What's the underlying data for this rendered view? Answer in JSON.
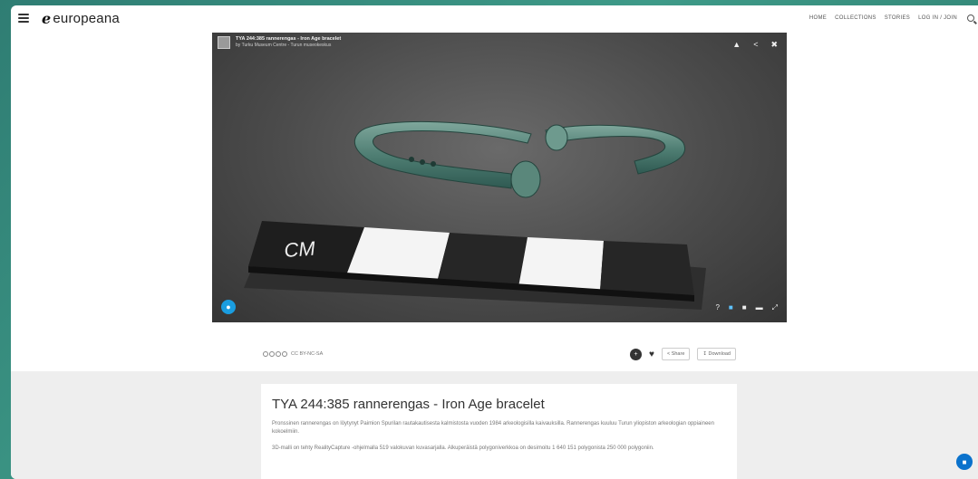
{
  "header": {
    "logo_mark": "e",
    "logo_text": "europeana",
    "nav": [
      "HOME",
      "COLLECTIONS",
      "STORIES",
      "LOG IN / JOIN"
    ]
  },
  "viewer": {
    "title": "TYA 244:385 rannerengas - Iron Age bracelet",
    "subtitle": "by Turku Museum Centre - Turun museokeskus",
    "scale_label": "CM"
  },
  "actions": {
    "license": "CC BY-NC-SA",
    "share": "Share",
    "download": "Download"
  },
  "record": {
    "title": "TYA 244:385 rannerengas - Iron Age bracelet",
    "description": "Pronssinen rannerengas on löytynyt Paimion Spurilan rautakautisesta kalmistosta vuoden 1984 arkeologisilla kaivauksilla. Rannerengas kuuluu Turun yliopiston arkeologian oppiaineen kokoelmiin.",
    "description2": "3D-malli on tehty RealityCapture -ohjelmalla 519 valokuvan kuvasarjalla. Alkuperäistä polygoniverkkoa on desimoitu 1 640 151 polygonista 250 000 polygoniin."
  },
  "colors": {
    "accent": "#0a72cc",
    "background_teal": "#3e9a88",
    "viewer_bg": "#4b4b4b"
  }
}
